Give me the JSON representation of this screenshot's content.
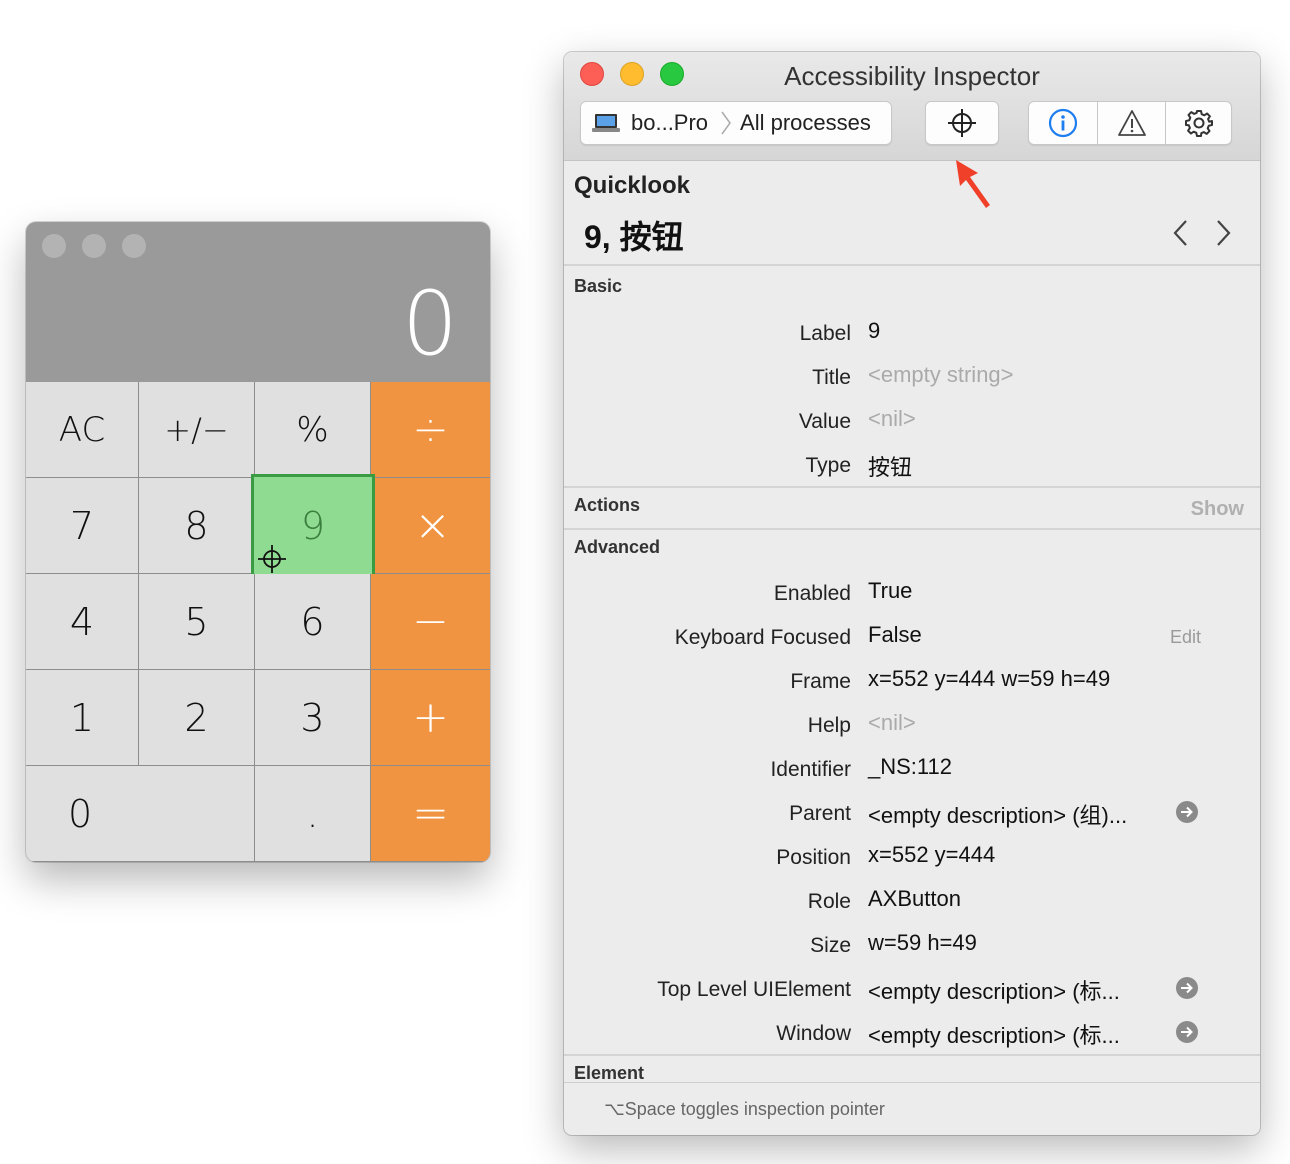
{
  "calculator": {
    "display": "0",
    "keys": [
      "AC",
      "+/−",
      "%",
      "÷",
      "7",
      "8",
      "9",
      "×",
      "4",
      "5",
      "6",
      "−",
      "1",
      "2",
      "3",
      "+",
      "0",
      ".",
      "="
    ],
    "highlight_color": "#8edb91",
    "operator_color": "#f19441"
  },
  "inspector": {
    "title": "Accessibility Inspector",
    "target_device": "bo...Pro",
    "target_process": "All processes",
    "toolbar_icons": [
      "laptop-icon",
      "crosshair-icon",
      "info-icon",
      "warning-icon",
      "gear-icon"
    ],
    "quicklook": {
      "heading": "Quicklook",
      "value": "9, 按钮"
    },
    "basic": {
      "heading": "Basic",
      "rows": [
        {
          "label": "Label",
          "value": "9"
        },
        {
          "label": "Title",
          "value": "<empty string>"
        },
        {
          "label": "Value",
          "value": "<nil>"
        },
        {
          "label": "Type",
          "value": "按钮"
        }
      ]
    },
    "actions": {
      "heading": "Actions",
      "show": "Show"
    },
    "advanced": {
      "heading": "Advanced",
      "edit": "Edit",
      "rows": [
        {
          "label": "Enabled",
          "value": "True"
        },
        {
          "label": "Keyboard Focused",
          "value": "False"
        },
        {
          "label": "Frame",
          "value": "x=552 y=444 w=59 h=49"
        },
        {
          "label": "Help",
          "value": "<nil>"
        },
        {
          "label": "Identifier",
          "value": "_NS:112"
        },
        {
          "label": "Parent",
          "value": "<empty description> (组)..."
        },
        {
          "label": "Position",
          "value": "x=552 y=444"
        },
        {
          "label": "Role",
          "value": "AXButton"
        },
        {
          "label": "Size",
          "value": "w=59 h=49"
        },
        {
          "label": "Top Level UIElement",
          "value": "<empty description> (标..."
        },
        {
          "label": "Window",
          "value": "<empty description> (标..."
        }
      ]
    },
    "element": {
      "heading": "Element"
    },
    "footer": "⌥Space toggles inspection pointer",
    "accent_color": "#1e7ef0",
    "arrow_color": "#f0402a"
  }
}
